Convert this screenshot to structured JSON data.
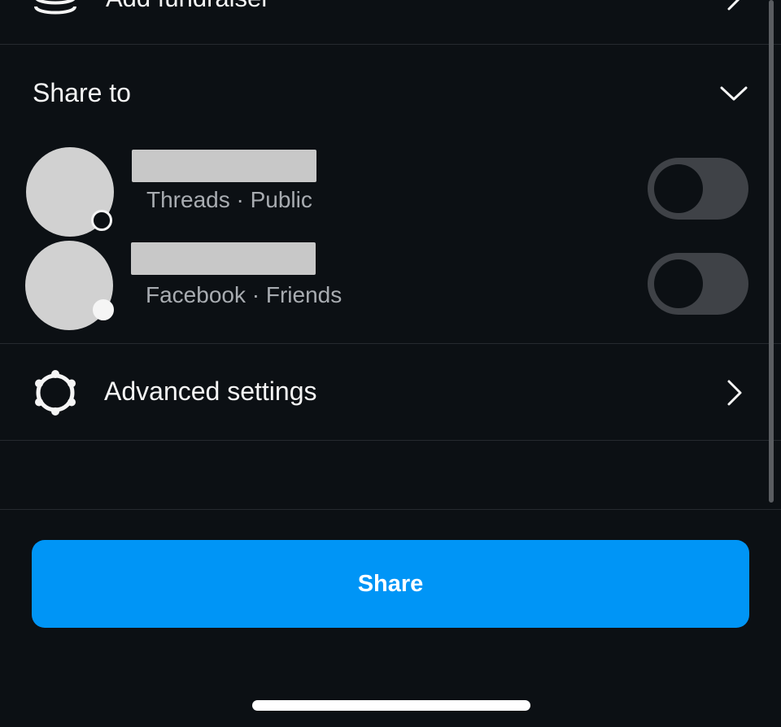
{
  "fundraiser": {
    "label": "Add fundraiser",
    "icon": "coins-stack-icon"
  },
  "share_to": {
    "title": "Share to",
    "expanded": true,
    "accounts": [
      {
        "meta": "Threads · Public",
        "platform_badge": "threads-icon",
        "enabled": false
      },
      {
        "meta": "Facebook · Friends",
        "platform_badge": "facebook-icon",
        "enabled": false
      }
    ]
  },
  "advanced": {
    "label": "Advanced settings",
    "icon": "gear-icon"
  },
  "actions": {
    "share_label": "Share"
  },
  "colors": {
    "background": "#0c1014",
    "accent": "#0095f6",
    "toggle_off": "#3f4247",
    "secondary_text": "#a8acb1"
  }
}
